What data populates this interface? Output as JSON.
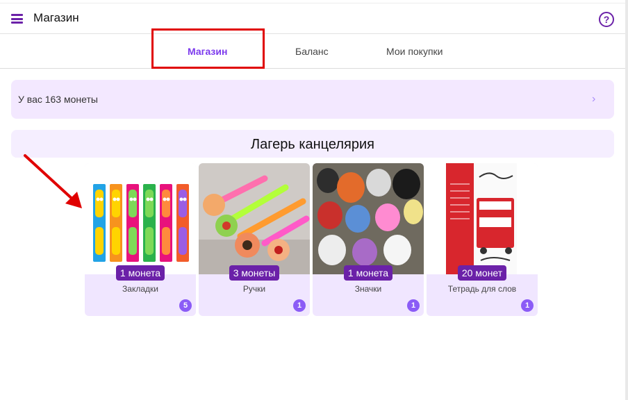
{
  "header": {
    "title": "Магазин",
    "help_icon": "question-icon",
    "menu_icon": "menu-icon",
    "accent_color": "#6b21a8"
  },
  "tabs": [
    {
      "label": "Магазин",
      "active": true
    },
    {
      "label": "Баланс",
      "active": false
    },
    {
      "label": "Мои покупки",
      "active": false
    }
  ],
  "balance": {
    "text": "У вас 163 монеты"
  },
  "section": {
    "title": "Лагерь канцелярия"
  },
  "products": [
    {
      "price": "1 монета",
      "name": "Закладки",
      "count": "5"
    },
    {
      "price": "3 монеты",
      "name": "Ручки",
      "count": "1"
    },
    {
      "price": "1 монета",
      "name": "Значки",
      "count": "1"
    },
    {
      "price": "20 монет",
      "name": "Тетрадь для слов",
      "count": "1"
    }
  ]
}
